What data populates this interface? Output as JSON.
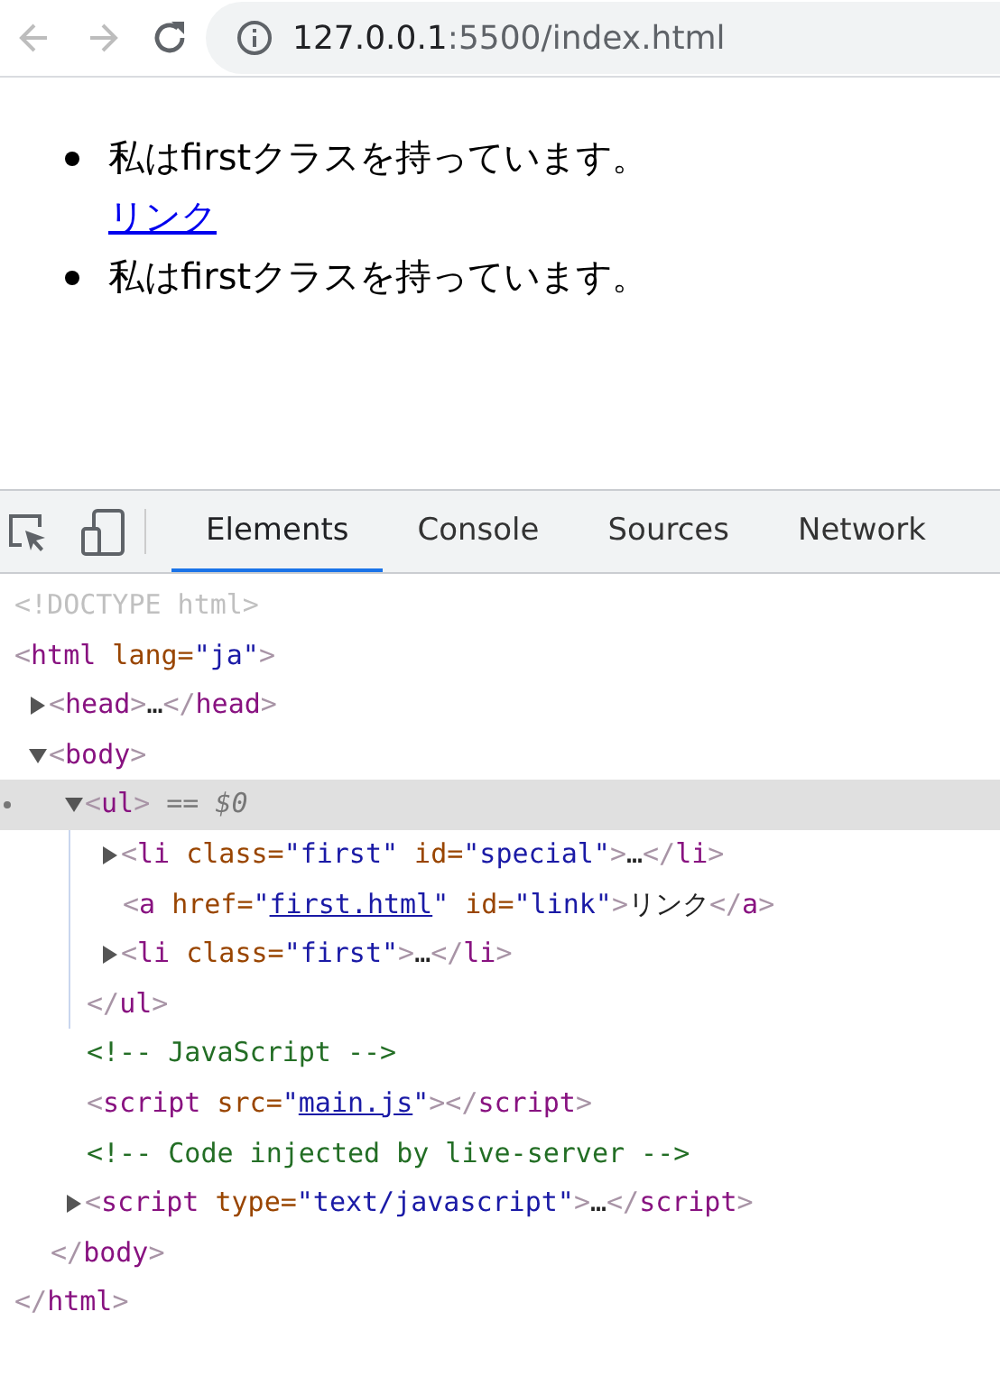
{
  "browser": {
    "back": {
      "disabled": true
    },
    "forward": {
      "disabled": true
    },
    "url_host": "127.0.0.1",
    "url_path": ":5500/index.html"
  },
  "page": {
    "items": [
      {
        "kind": "item",
        "text": "私はfirstクラスを持っています。"
      },
      {
        "kind": "link",
        "text": "リンク"
      },
      {
        "kind": "item",
        "text": "私はfirstクラスを持っています。"
      }
    ]
  },
  "devtools": {
    "tabs": [
      {
        "label": "Elements",
        "selected": true
      },
      {
        "label": "Console",
        "selected": false
      },
      {
        "label": "Sources",
        "selected": false
      },
      {
        "label": "Network",
        "selected": false
      }
    ],
    "dom_tree": [
      {
        "selected": false,
        "tokens": [
          {
            "kind": "doctype",
            "text": "<!DOCTYPE html>"
          }
        ]
      },
      {
        "selected": false,
        "tokens": [
          {
            "kind": "punct",
            "text": "<"
          },
          {
            "kind": "tag",
            "text": "html"
          },
          {
            "kind": "attr",
            "text": " lang="
          },
          {
            "kind": "value",
            "text": "\"ja\""
          },
          {
            "kind": "punct",
            "text": ">"
          }
        ],
        "closing": [
          {
            "kind": "punct",
            "text": "</"
          },
          {
            "kind": "tag",
            "text": "html"
          },
          {
            "kind": "punct",
            "text": ">"
          }
        ],
        "children": [
          {
            "selected": false,
            "expanded": false,
            "tokens": [
              {
                "kind": "punct",
                "text": "<"
              },
              {
                "kind": "tag",
                "text": "head"
              },
              {
                "kind": "punct",
                "text": ">"
              },
              {
                "kind": "text",
                "text": "…"
              },
              {
                "kind": "punct",
                "text": "</"
              },
              {
                "kind": "tag",
                "text": "head"
              },
              {
                "kind": "punct",
                "text": ">"
              }
            ]
          },
          {
            "selected": false,
            "expanded": true,
            "tokens": [
              {
                "kind": "punct",
                "text": "<"
              },
              {
                "kind": "tag",
                "text": "body"
              },
              {
                "kind": "punct",
                "text": ">"
              }
            ],
            "closing": [
              {
                "kind": "punct",
                "text": "</"
              },
              {
                "kind": "tag",
                "text": "body"
              },
              {
                "kind": "punct",
                "text": ">"
              }
            ],
            "children": [
              {
                "selected": true,
                "expanded": true,
                "tokens": [
                  {
                    "kind": "punct",
                    "text": "<"
                  },
                  {
                    "kind": "tag",
                    "text": "ul"
                  },
                  {
                    "kind": "punct",
                    "text": ">"
                  },
                  {
                    "kind": "hint",
                    "text": " == $0"
                  }
                ],
                "closing": [
                  {
                    "kind": "punct",
                    "text": "</"
                  },
                  {
                    "kind": "tag",
                    "text": "ul"
                  },
                  {
                    "kind": "punct",
                    "text": ">"
                  }
                ],
                "children": [
                  {
                    "selected": false,
                    "expanded": false,
                    "tokens": [
                      {
                        "kind": "punct",
                        "text": "<"
                      },
                      {
                        "kind": "tag",
                        "text": "li"
                      },
                      {
                        "kind": "attr",
                        "text": " class="
                      },
                      {
                        "kind": "value",
                        "text": "\"first\""
                      },
                      {
                        "kind": "attr",
                        "text": " id="
                      },
                      {
                        "kind": "value",
                        "text": "\"special\""
                      },
                      {
                        "kind": "punct",
                        "text": ">"
                      },
                      {
                        "kind": "text",
                        "text": "…"
                      },
                      {
                        "kind": "punct",
                        "text": "</"
                      },
                      {
                        "kind": "tag",
                        "text": "li"
                      },
                      {
                        "kind": "punct",
                        "text": ">"
                      }
                    ]
                  },
                  {
                    "selected": false,
                    "tokens": [
                      {
                        "kind": "punct",
                        "text": "<"
                      },
                      {
                        "kind": "tag",
                        "text": "a"
                      },
                      {
                        "kind": "attr",
                        "text": " href="
                      },
                      {
                        "kind": "value",
                        "text": "\""
                      },
                      {
                        "kind": "link",
                        "text": "first.html"
                      },
                      {
                        "kind": "value",
                        "text": "\""
                      },
                      {
                        "kind": "attr",
                        "text": " id="
                      },
                      {
                        "kind": "value",
                        "text": "\"link\""
                      },
                      {
                        "kind": "punct",
                        "text": ">"
                      },
                      {
                        "kind": "text",
                        "text": "リンク"
                      },
                      {
                        "kind": "punct",
                        "text": "</"
                      },
                      {
                        "kind": "tag",
                        "text": "a"
                      },
                      {
                        "kind": "punct",
                        "text": ">"
                      }
                    ]
                  },
                  {
                    "selected": false,
                    "expanded": false,
                    "tokens": [
                      {
                        "kind": "punct",
                        "text": "<"
                      },
                      {
                        "kind": "tag",
                        "text": "li"
                      },
                      {
                        "kind": "attr",
                        "text": " class="
                      },
                      {
                        "kind": "value",
                        "text": "\"first\""
                      },
                      {
                        "kind": "punct",
                        "text": ">"
                      },
                      {
                        "kind": "text",
                        "text": "…"
                      },
                      {
                        "kind": "punct",
                        "text": "</"
                      },
                      {
                        "kind": "tag",
                        "text": "li"
                      },
                      {
                        "kind": "punct",
                        "text": ">"
                      }
                    ]
                  }
                ]
              },
              {
                "selected": false,
                "tokens": [
                  {
                    "kind": "comment",
                    "text": "<!-- JavaScript -->"
                  }
                ]
              },
              {
                "selected": false,
                "tokens": [
                  {
                    "kind": "punct",
                    "text": "<"
                  },
                  {
                    "kind": "tag",
                    "text": "script"
                  },
                  {
                    "kind": "attr",
                    "text": " src="
                  },
                  {
                    "kind": "value",
                    "text": "\""
                  },
                  {
                    "kind": "link",
                    "text": "main.js"
                  },
                  {
                    "kind": "value",
                    "text": "\""
                  },
                  {
                    "kind": "punct",
                    "text": "></"
                  },
                  {
                    "kind": "tag",
                    "text": "script"
                  },
                  {
                    "kind": "punct",
                    "text": ">"
                  }
                ]
              },
              {
                "selected": false,
                "tokens": [
                  {
                    "kind": "comment",
                    "text": "<!-- Code injected by live-server -->"
                  }
                ]
              },
              {
                "selected": false,
                "expanded": false,
                "tokens": [
                  {
                    "kind": "punct",
                    "text": "<"
                  },
                  {
                    "kind": "tag",
                    "text": "script"
                  },
                  {
                    "kind": "attr",
                    "text": " type="
                  },
                  {
                    "kind": "value",
                    "text": "\"text/javascript\""
                  },
                  {
                    "kind": "punct",
                    "text": ">"
                  },
                  {
                    "kind": "text",
                    "text": "…"
                  },
                  {
                    "kind": "punct",
                    "text": "</"
                  },
                  {
                    "kind": "tag",
                    "text": "script"
                  },
                  {
                    "kind": "punct",
                    "text": ">"
                  }
                ]
              }
            ]
          }
        ]
      }
    ]
  }
}
